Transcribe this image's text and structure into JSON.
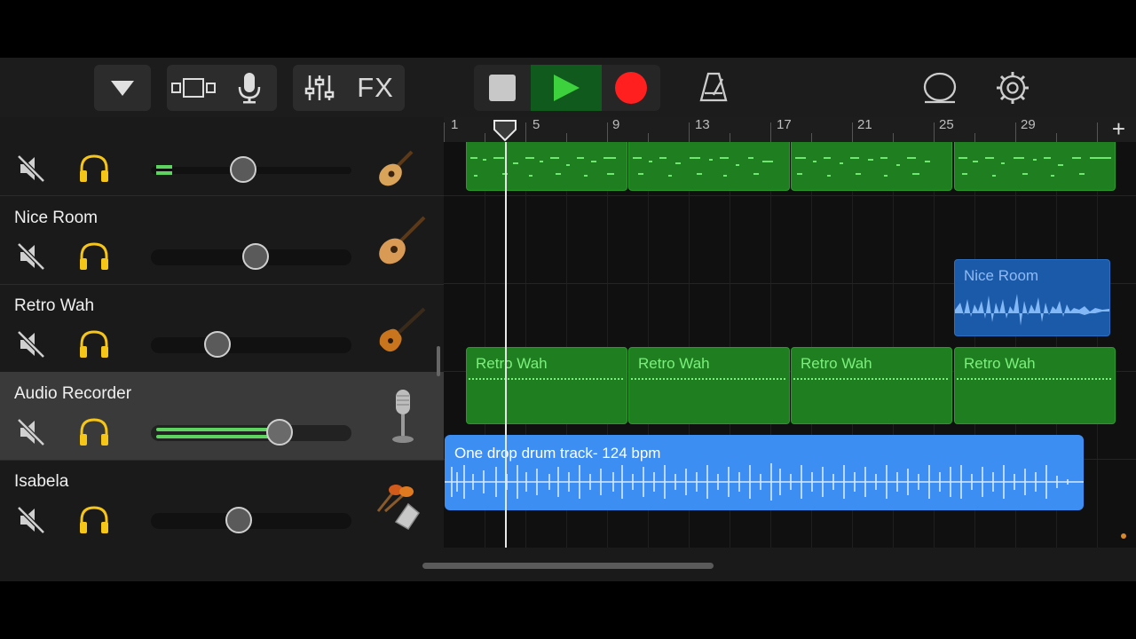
{
  "toolbar": {
    "fx_label": "FX"
  },
  "ruler": {
    "bar_numbers": [
      "1",
      "5",
      "9",
      "13",
      "17",
      "21",
      "25",
      "29"
    ],
    "add_label": "+"
  },
  "tracks": [
    {
      "name": "",
      "instrument_icon": "acoustic-guitar-icon",
      "volume": 0.46
    },
    {
      "name": "Nice Room",
      "instrument_icon": "acoustic-guitar-icon",
      "volume": 0.52
    },
    {
      "name": "Retro Wah",
      "instrument_icon": "electric-guitar-icon",
      "volume": 0.33
    },
    {
      "name": "Audio Recorder",
      "instrument_icon": "microphone-icon",
      "volume": 0.66
    },
    {
      "name": "Isabela",
      "instrument_icon": "percussion-icon",
      "volume": 0.44
    }
  ],
  "regions": {
    "nice_room": "Nice Room",
    "retro_wah": [
      "Retro Wah",
      "Retro Wah",
      "Retro Wah",
      "Retro Wah"
    ],
    "drum_track": "One drop drum track- 124 bpm"
  },
  "colors": {
    "record": "#ff1f1f",
    "play": "#3dd13d",
    "green_region": "#1f7e1f",
    "blue_region": "#1a5aa8",
    "drum_region": "#3d8ef2",
    "solo": "#f5c518"
  }
}
